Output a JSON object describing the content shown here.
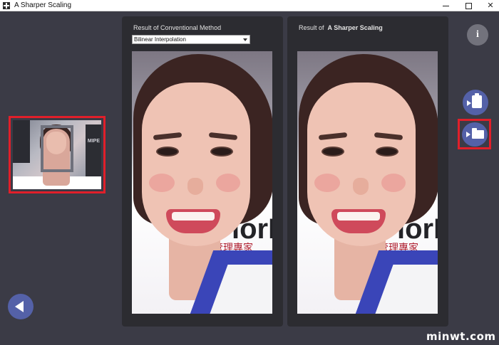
{
  "window": {
    "title": "A Sharper Scaling",
    "icon": "app-icon",
    "controls": {
      "minimize": "minimize-icon",
      "maximize": "maximize-icon",
      "close": "✕"
    }
  },
  "left_panel": {
    "label_prefix": "Result of Conventional Method",
    "method_select": {
      "selected": "Bilinear Interpolation"
    }
  },
  "right_panel": {
    "label_prefix": "Result of",
    "label_emphasis": "A Sharper Scaling"
  },
  "photo": {
    "sign_text": "iorEx",
    "sign_subtext": "管理專家"
  },
  "thumbnail": {
    "sign_text": "MIPE"
  },
  "buttons": {
    "info": "i",
    "paste_icon": "clipboard-icon",
    "open_icon": "folder-icon",
    "back_icon": "back-arrow-icon"
  },
  "watermark": "minwt.com",
  "colors": {
    "background": "#3b3b46",
    "panel": "#2c2c31",
    "accent_button": "#5461a8",
    "highlight_border": "#e11f2a"
  }
}
